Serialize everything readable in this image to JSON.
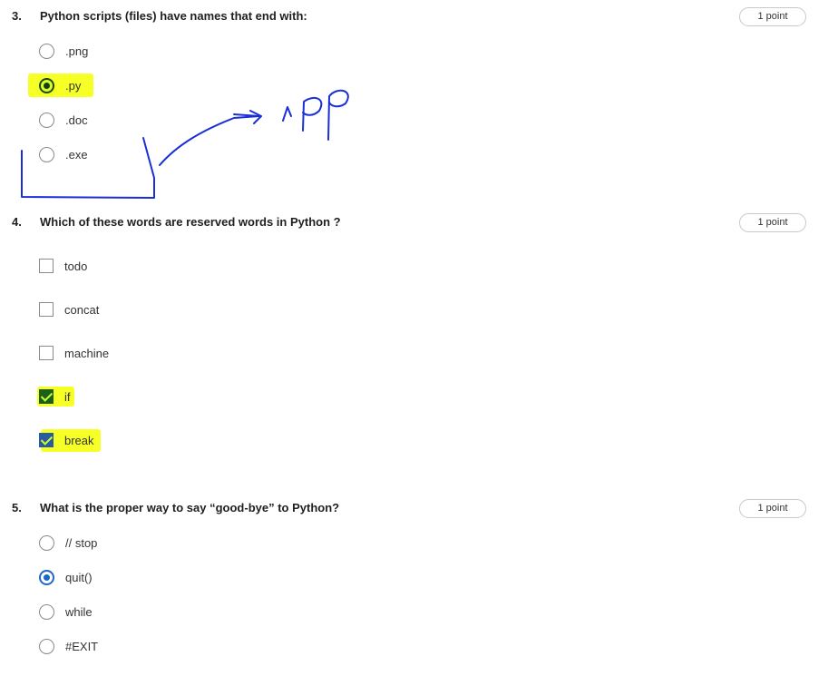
{
  "questions": [
    {
      "number": "3.",
      "text": "Python scripts (files) have names that end with:",
      "points": "1 point",
      "type": "radio",
      "options": [
        ".png",
        ".py",
        ".doc",
        ".exe"
      ],
      "selected": ".py"
    },
    {
      "number": "4.",
      "text": "Which of these words are reserved words in Python ?",
      "points": "1 point",
      "type": "checkbox",
      "options": [
        "todo",
        "concat",
        "machine",
        "if",
        "break"
      ],
      "checked": [
        "if",
        "break"
      ]
    },
    {
      "number": "5.",
      "text": "What is the proper way to say “good-bye” to Python?",
      "points": "1 point",
      "type": "radio",
      "options": [
        "// stop",
        "quit()",
        "while",
        "#EXIT"
      ],
      "selected": "quit()"
    }
  ],
  "colors": {
    "highlight": "#f2f50a",
    "selection_blue": "#1c67c9",
    "ink": "#1b2fd6"
  }
}
